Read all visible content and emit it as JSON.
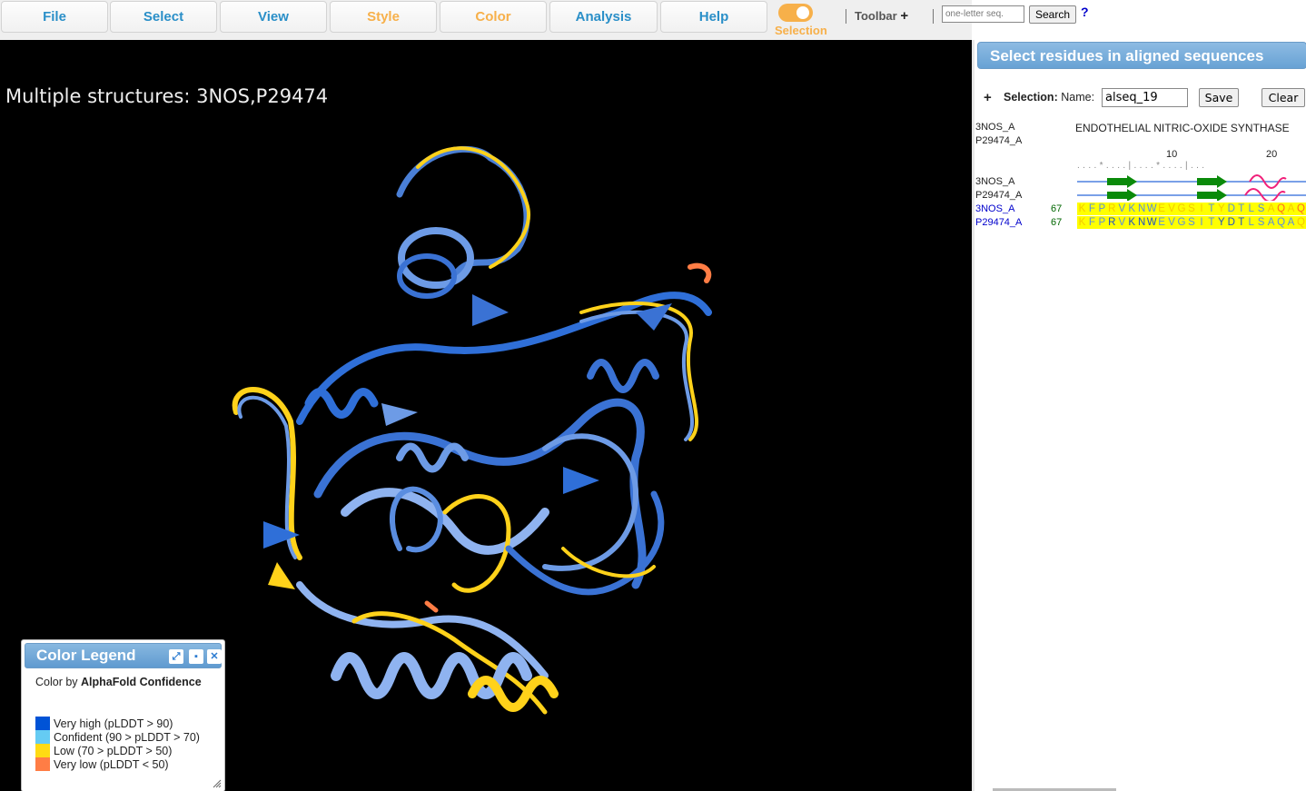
{
  "menubar": {
    "items": [
      {
        "label": "File",
        "color": "#2a8fc8"
      },
      {
        "label": "Select",
        "color": "#2a8fc8"
      },
      {
        "label": "View",
        "color": "#2a8fc8"
      },
      {
        "label": "Style",
        "color": "#f7b04a"
      },
      {
        "label": "Color",
        "color": "#f7b04a"
      },
      {
        "label": "Analysis",
        "color": "#2a8fc8"
      },
      {
        "label": "Help",
        "color": "#2a8fc8"
      }
    ],
    "selection_toggle": {
      "label": "Selection",
      "on": true
    },
    "toolbar_label": "Toolbar",
    "toolbar_plus": "+",
    "search": {
      "placeholder": "one-letter seq.",
      "value": "",
      "button": "Search",
      "help": "?"
    }
  },
  "viewer": {
    "title": "Multiple structures: 3NOS,P29474"
  },
  "legend": {
    "title": "Color Legend",
    "subtitle_prefix": "Color by",
    "subtitle_bold": "AlphaFold Confidence",
    "items": [
      {
        "label": "Very high (pLDDT > 90)",
        "color": "#0053d6"
      },
      {
        "label": "Confident (90 > pLDDT > 70)",
        "color": "#65cbf3"
      },
      {
        "label": "Low (70 > pLDDT > 50)",
        "color": "#ffdb13"
      },
      {
        "label": "Very low (pLDDT < 50)",
        "color": "#ff7d45"
      }
    ],
    "icons": [
      "expand-icon",
      "save-icon",
      "close-icon"
    ]
  },
  "panel": {
    "title": "Select residues in aligned sequences",
    "plus": "+",
    "selection_label": "Selection:",
    "name_label": "Name:",
    "name_value": "alseq_19",
    "save": "Save",
    "clear": "Clear",
    "header_chains": [
      "3NOS_A",
      "P29474_A"
    ],
    "description": "ENDOTHELIAL NITRIC-OXIDE SYNTHASE",
    "ruler": {
      "ticks": [
        "10",
        "20"
      ],
      "dots": ". . . . * . . . . | . . . . * . . . . | . . ."
    },
    "ss_rows": [
      "3NOS_A",
      "P29474_A"
    ],
    "seq_rows": [
      {
        "chain": "3NOS_A",
        "start": "67",
        "residues": [
          "K",
          "F",
          "P",
          "R",
          "V",
          "K",
          "N",
          "W",
          "E",
          "V",
          "G",
          "S",
          "I",
          "T",
          "Y",
          "D",
          "T",
          "L",
          "S",
          "A",
          "Q",
          "A",
          "Q"
        ],
        "confidence": [
          "low",
          "conf",
          "conf",
          "low",
          "conf",
          "conf",
          "conf",
          "conf",
          "low",
          "low",
          "low",
          "low",
          "low",
          "conf",
          "low",
          "conf",
          "conf",
          "conf",
          "conf",
          "low",
          "vlow",
          "low",
          "vlow"
        ]
      },
      {
        "chain": "P29474_A",
        "start": "67",
        "residues": [
          "K",
          "F",
          "P",
          "R",
          "V",
          "K",
          "N",
          "W",
          "E",
          "V",
          "G",
          "S",
          "I",
          "T",
          "Y",
          "D",
          "T",
          "L",
          "S",
          "A",
          "Q",
          "A",
          "Q"
        ],
        "confidence": [
          "low",
          "conf",
          "conf",
          "vhigh",
          "conf",
          "vhigh",
          "vhigh",
          "vhigh",
          "conf",
          "conf",
          "conf",
          "conf",
          "conf",
          "conf",
          "vhigh",
          "vhigh",
          "vhigh",
          "conf",
          "conf",
          "conf",
          "conf",
          "conf",
          "low"
        ]
      }
    ],
    "residue_colors": {
      "vhigh": "#1f4fc4",
      "conf": "#5a8de0",
      "low": "#f5c800",
      "vlow": "#ff6a20"
    }
  }
}
